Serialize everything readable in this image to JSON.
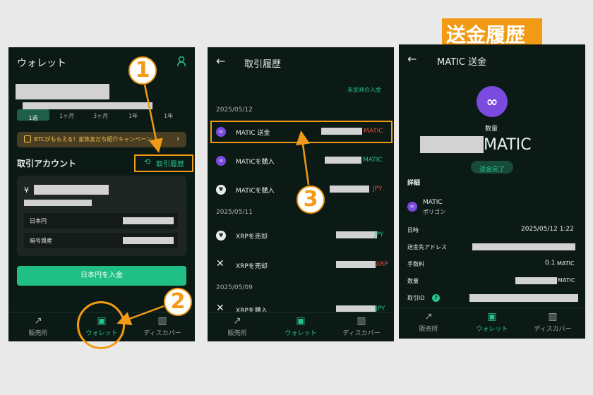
{
  "heading": "送金履歴",
  "screen1": {
    "title": "ウォレット",
    "periods": [
      "1週",
      "1ヶ月",
      "3ヶ月",
      "1年",
      "1年"
    ],
    "banner": "BTCがもらえる！家族友だち紹介キャンペーン",
    "section_title": "取引アカウント",
    "history_button": "取引履歴",
    "yen_symbol": "¥",
    "rows": [
      "日本円",
      "暗号資産"
    ],
    "deposit_button": "日本円を入金"
  },
  "screen2": {
    "title": "取引履歴",
    "unreflected": "未反映の入金",
    "dates": [
      "2025/05/12",
      "2025/05/11",
      "2025/05/09"
    ],
    "items": [
      {
        "label": "MATIC 送金",
        "unit": "MATIC",
        "color": "red"
      },
      {
        "label": "MATICを購入",
        "unit": "MATIC",
        "color": "green"
      },
      {
        "label": "MATICを購入",
        "unit": "JPY",
        "color": "red"
      },
      {
        "label": "XRPを売却",
        "unit": "JPY",
        "color": "green"
      },
      {
        "label": "XRPを売却",
        "unit": "XRP",
        "color": "red"
      },
      {
        "label": "XRPを購入",
        "unit": "JPY",
        "color": "green"
      }
    ]
  },
  "screen3": {
    "title": "MATIC 送金",
    "quantity_label": "数量",
    "amount_unit": "MATIC",
    "status": "送金完了",
    "details_title": "詳細",
    "coin_name": "MATIC",
    "network": "ポリゴン",
    "fields": [
      {
        "label": "日時",
        "value": "2025/05/12 1:22"
      },
      {
        "label": "送金先アドレス",
        "value": ""
      },
      {
        "label": "手数料",
        "value": "0.1",
        "unit": "MATIC"
      },
      {
        "label": "数量",
        "value": "",
        "unit": "MATIC"
      },
      {
        "label": "取引ID",
        "value": ""
      }
    ]
  },
  "tabbar": [
    "販売所",
    "ウォレット",
    "ディスカバー"
  ],
  "badges": [
    "1",
    "2",
    "3"
  ],
  "colors": {
    "accent": "#26c28d",
    "highlight": "#f29a14",
    "background": "#0c1a16",
    "send_red": "#e0503a",
    "polygon": "#7b4be0"
  }
}
